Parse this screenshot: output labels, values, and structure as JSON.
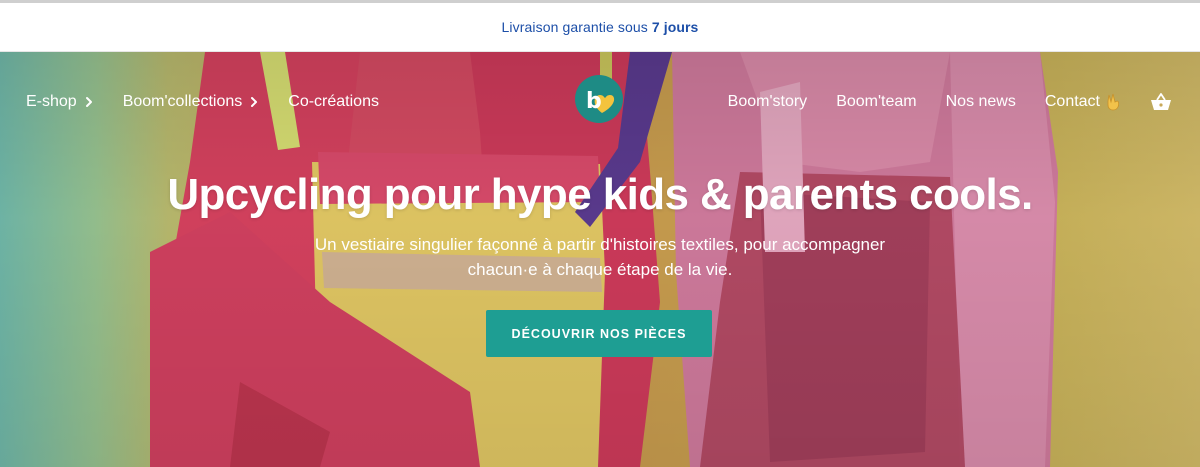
{
  "announcement": {
    "text": "Livraison garantie sous",
    "highlight": "7 jours"
  },
  "nav": {
    "left": [
      {
        "label": "E-shop",
        "has_chevron": true
      },
      {
        "label": "Boom'collections",
        "has_chevron": true
      },
      {
        "label": "Co-créations",
        "has_chevron": false
      }
    ],
    "right": [
      {
        "label": "Boom'story"
      },
      {
        "label": "Boom'team"
      },
      {
        "label": "Nos news"
      },
      {
        "label": "Contact",
        "icon": "victory-hand-icon"
      }
    ],
    "cart_icon": "basket-icon"
  },
  "logo": {
    "letter": "b",
    "icon": "heart-icon"
  },
  "hero": {
    "headline": "Upcycling pour hype kids & parents cools.",
    "subline": "Un vestiaire singulier façonné à partir d'histoires textiles, pour accompagner chacun·e à chaque étape de la vie.",
    "cta_label": "DÉCOUVRIR NOS PIÈCES"
  },
  "colors": {
    "announcement_text": "#1d4fa8",
    "accent": "#1e9e93",
    "logo_bg": "#1e8b85",
    "logo_heart": "#f3c33d"
  }
}
